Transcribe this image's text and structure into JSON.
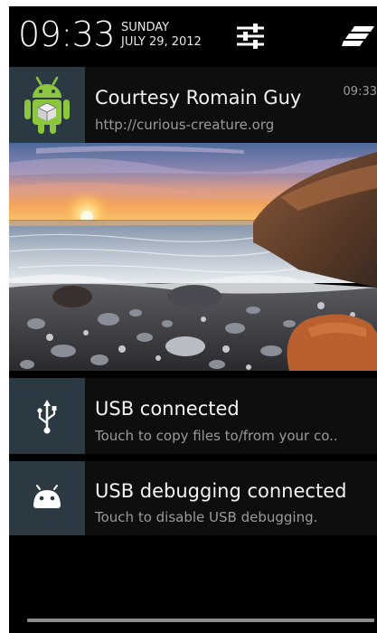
{
  "status_header": {
    "time": "09:33",
    "day": "SUNDAY",
    "date": "JULY 29, 2012"
  },
  "notifications": [
    {
      "title": "Courtesy Romain Guy",
      "text": "http://curious-creature.org",
      "time": "09:33",
      "icon": "android-robot-icon"
    },
    {
      "title": "USB connected",
      "text": "Touch to copy files to/from your co..",
      "icon": "usb-icon"
    },
    {
      "title": "USB debugging connected",
      "text": "Touch to disable USB debugging.",
      "icon": "android-head-icon"
    }
  ],
  "colors": {
    "background": "#000000",
    "icon_box": "#2a3942",
    "notification_bg": "#0e0e0e",
    "title_text": "#f2f2f2",
    "secondary_text": "#9a9a9a"
  }
}
